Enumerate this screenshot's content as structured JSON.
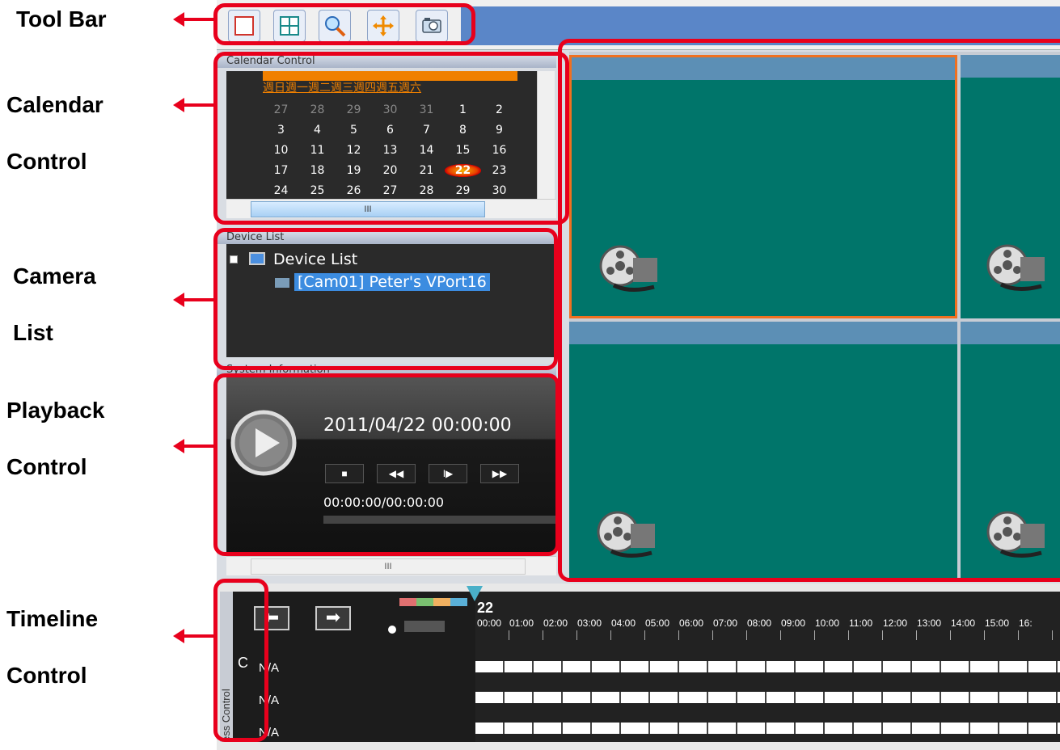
{
  "callouts": {
    "toolbar": "Tool Bar",
    "calendar_1": "Calendar",
    "calendar_2": "Control",
    "camera_1": "Camera",
    "camera_2": "List",
    "playback_1": "Playback",
    "playback_2": "Control",
    "timeline_1": "Timeline",
    "timeline_2": "Control"
  },
  "calendar": {
    "title": "Calendar Control",
    "weekdays": "週日週一週二週三週四週五週六",
    "weeks": [
      [
        "27",
        "28",
        "29",
        "30",
        "31",
        "1",
        "2"
      ],
      [
        "3",
        "4",
        "5",
        "6",
        "7",
        "8",
        "9"
      ],
      [
        "10",
        "11",
        "12",
        "13",
        "14",
        "15",
        "16"
      ],
      [
        "17",
        "18",
        "19",
        "20",
        "21",
        "22",
        "23"
      ],
      [
        "24",
        "25",
        "26",
        "27",
        "28",
        "29",
        "30"
      ]
    ],
    "scroll_thumb": "III"
  },
  "device_list": {
    "title": "Device List",
    "root_label": "Device List",
    "camera_label": "[Cam01] Peter's VPort16"
  },
  "system_info": {
    "title": "System Information"
  },
  "playback": {
    "datetime": "2011/04/22 00:00:00",
    "time_counter": "00:00:00/00:00:00",
    "stop_label": "■",
    "rewind_label": "◀◀",
    "step_label": "I▶",
    "ff_label": "▶▶",
    "scroll_thumb": "III"
  },
  "timeline": {
    "day": "22",
    "vertical_label": "ess Control",
    "c_letter": "C",
    "hours": [
      "00:00",
      "01:00",
      "02:00",
      "03:00",
      "04:00",
      "05:00",
      "06:00",
      "07:00",
      "08:00",
      "09:00",
      "10:00",
      "11:00",
      "12:00",
      "13:00",
      "14:00",
      "15:00",
      "16:"
    ],
    "rows": [
      "N/A",
      "N/A",
      "N/A"
    ]
  },
  "colors": {
    "annotation_red": "#e8001c",
    "video_bg": "#00756a",
    "selected_border": "#f07020",
    "calendar_accent": "#f08000"
  }
}
